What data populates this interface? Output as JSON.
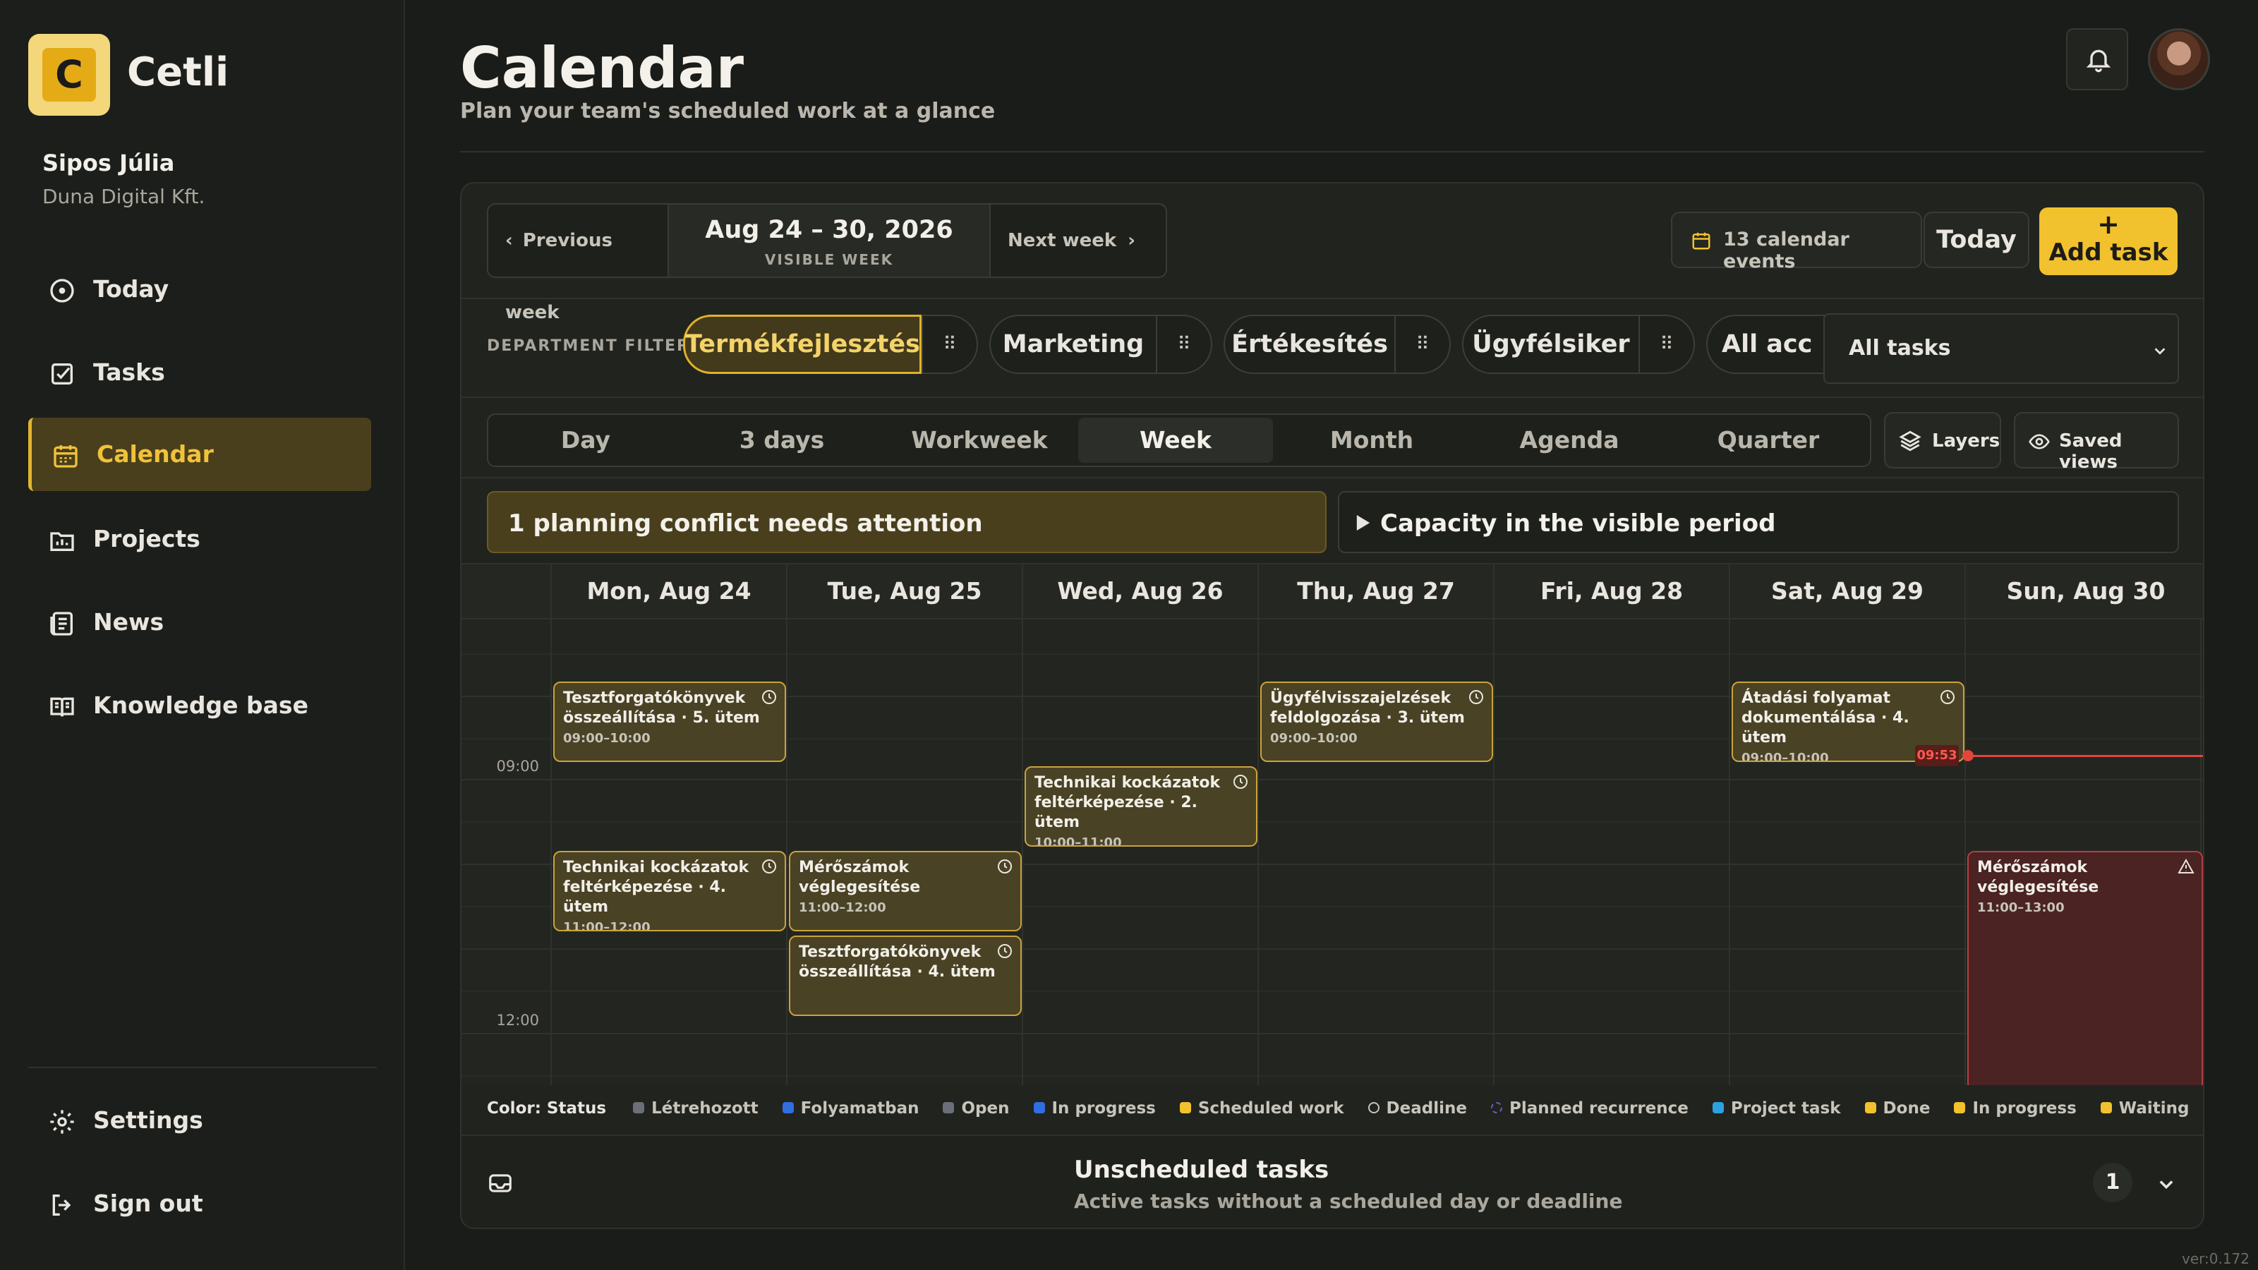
{
  "app": {
    "brand": "Cetli",
    "logo_letter": "C",
    "version": "ver:0.172"
  },
  "user": {
    "name": "Sipos Júlia",
    "org": "Duna Digital Kft."
  },
  "nav": [
    {
      "label": "Today",
      "icon": "clock-icon"
    },
    {
      "label": "Tasks",
      "icon": "checkbox-icon"
    },
    {
      "label": "Calendar",
      "icon": "calendar-icon",
      "active": true
    },
    {
      "label": "Projects",
      "icon": "chart-icon"
    },
    {
      "label": "News",
      "icon": "newspaper-icon"
    },
    {
      "label": "Knowledge base",
      "icon": "book-icon"
    }
  ],
  "nav_bottom": [
    {
      "label": "Settings",
      "icon": "gear-icon"
    },
    {
      "label": "Sign out",
      "icon": "sign-out-icon"
    }
  ],
  "header": {
    "title": "Calendar",
    "subtitle": "Plan your team's scheduled work at a glance"
  },
  "week_nav": {
    "prev": "Previous week",
    "next": "Next week",
    "range": "Aug 24 – 30, 2026",
    "range_label": "VISIBLE WEEK"
  },
  "toolbar": {
    "events": "13 calendar events",
    "today": "Today",
    "add": "Add task",
    "add_icon": "+"
  },
  "filter": {
    "label": "DEPARTMENT FILTER",
    "chips": [
      "Termékfejlesztés",
      "Marketing",
      "Értékesítés",
      "Ügyfélsiker",
      "All acc"
    ],
    "select_value": "All tasks"
  },
  "views": {
    "tabs": [
      "Day",
      "3 days",
      "Workweek",
      "Week",
      "Month",
      "Agenda",
      "Quarter"
    ],
    "active": "Week",
    "layers": "Layers",
    "saved": "Saved views"
  },
  "alerts": {
    "conflict": "1 planning conflict needs attention",
    "capacity": "Capacity in the visible period"
  },
  "days": [
    "Mon, Aug 24",
    "Tue, Aug 25",
    "Wed, Aug 26",
    "Thu, Aug 27",
    "Fri, Aug 28",
    "Sat, Aug 29",
    "Sun, Aug 30"
  ],
  "time_labels": {
    "t9": "09:00",
    "t12": "12:00"
  },
  "now_label": "09:53",
  "events": [
    {
      "title": "Tesztforgatókönyvek összeállítása · 5. ütem",
      "time": "09:00–10:00",
      "day": 0
    },
    {
      "title": "Ügyfélvisszajelzések feldolgozása · 3. ütem",
      "time": "09:00–10:00",
      "day": 3
    },
    {
      "title": "Átadási folyamat dokumentálása · 4. ütem",
      "time": "09:00–10:00",
      "day": 5
    },
    {
      "title": "Technikai kockázatok feltérképezése · 2. ütem",
      "time": "10:00–11:00",
      "day": 2
    },
    {
      "title": "Technikai kockázatok feltérképezése · 4. ütem",
      "time": "11:00–12:00",
      "day": 0
    },
    {
      "title": "Mérőszámok véglegesítése",
      "time": "11:00–12:00",
      "day": 1
    },
    {
      "title": "Mérőszámok véglegesítése",
      "time": "11:00–13:00",
      "day": 6
    },
    {
      "title": "Tesztforgatókönyvek összeállítása · 4. ütem",
      "time": "",
      "day": 1
    }
  ],
  "legend": {
    "title": "Color: Status",
    "items": [
      {
        "label": "Létrehozott",
        "color": "#6b6f78"
      },
      {
        "label": "Folyamatban",
        "color": "#2f6fe0"
      },
      {
        "label": "Open",
        "color": "#6b6f78"
      },
      {
        "label": "In progress",
        "color": "#2f6fe0"
      },
      {
        "label": "Scheduled work",
        "color": "#f2c12e"
      },
      {
        "label": "Deadline",
        "color": "clock"
      },
      {
        "label": "Planned recurrence",
        "color": "#6a5acd"
      },
      {
        "label": "Project task",
        "color": "#2aa3e0"
      },
      {
        "label": "Done",
        "color": "#f2c12e"
      },
      {
        "label": "In progress",
        "color": "#f2c12e"
      },
      {
        "label": "Waiting",
        "color": "#f2c12e"
      }
    ]
  },
  "unscheduled": {
    "title": "Unscheduled tasks",
    "subtitle": "Active tasks without a scheduled day or deadline",
    "count": "1"
  }
}
